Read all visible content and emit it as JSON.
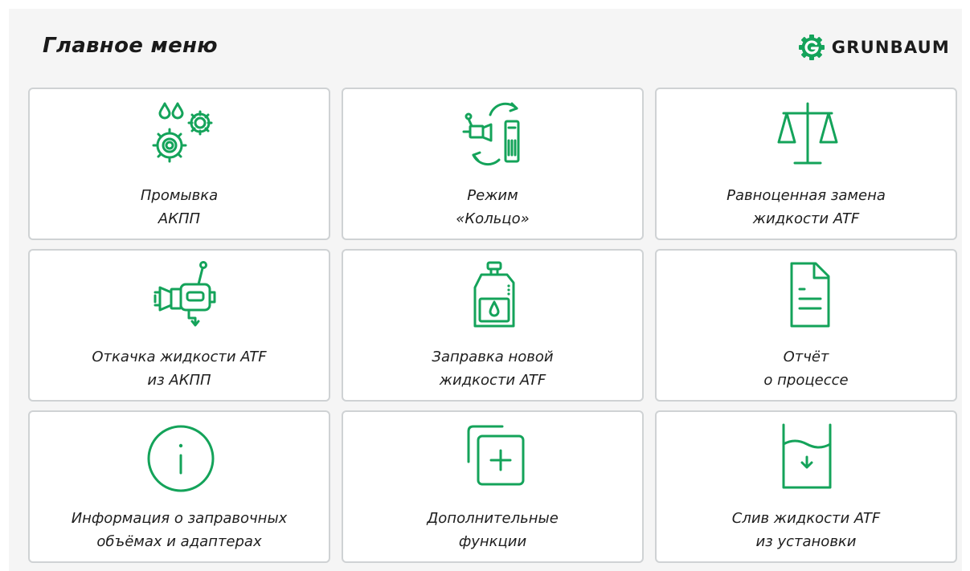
{
  "header": {
    "title": "Главное меню",
    "brand": "GRUNBAUM"
  },
  "colors": {
    "accent": "#14a35a",
    "background": "#f5f5f5",
    "tile_background": "#ffffff",
    "tile_border": "#cfd2d4"
  },
  "tiles": [
    {
      "icon": "gears-drops-icon",
      "line1": "Промывка",
      "line2": "АКПП"
    },
    {
      "icon": "ring-mode-icon",
      "line1": "Режим",
      "line2": "«Кольцо»"
    },
    {
      "icon": "scales-icon",
      "line1": "Равноценная замена",
      "line2": "жидкости ATF"
    },
    {
      "icon": "transmission-pump-icon",
      "line1": "Откачка жидкости ATF",
      "line2": "из АКПП"
    },
    {
      "icon": "oil-canister-icon",
      "line1": "Заправка новой",
      "line2": "жидкости ATF"
    },
    {
      "icon": "document-icon",
      "line1": "Отчёт",
      "line2": "о процессе"
    },
    {
      "icon": "info-icon",
      "line1": "Информация о заправочных",
      "line2": "объёмах и адаптерах"
    },
    {
      "icon": "add-copy-icon",
      "line1": "Дополнительные",
      "line2": "функции"
    },
    {
      "icon": "drain-tank-icon",
      "line1": "Слив жидкости ATF",
      "line2": "из установки"
    }
  ]
}
